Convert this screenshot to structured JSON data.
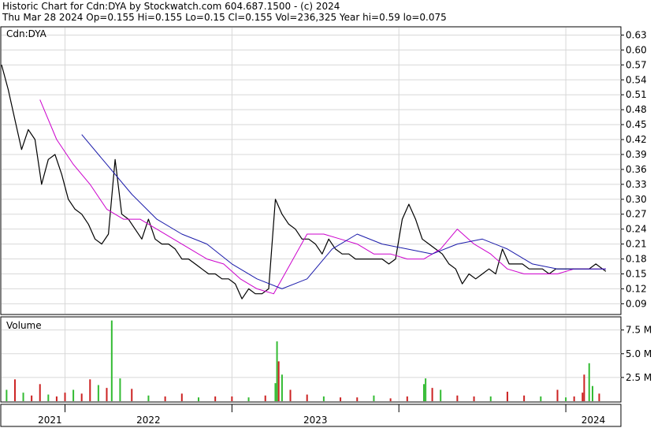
{
  "header": {
    "line1": "Historic Chart for Cdn:DYA by Stockwatch.com 604.687.1500 - (c) 2024",
    "line2": "Thu Mar 28 2024   Op=0.155  Hi=0.155  Lo=0.15  Cl=0.155  Vol=236,325   Year hi=0.59   lo=0.075"
  },
  "chart_data": [
    {
      "type": "line",
      "title": "Cdn:DYA",
      "y_ticks": [
        "0.63",
        "0.60",
        "0.57",
        "0.54",
        "0.51",
        "0.48",
        "0.45",
        "0.42",
        "0.39",
        "0.36",
        "0.33",
        "0.30",
        "0.27",
        "0.24",
        "0.21",
        "0.18",
        "0.15",
        "0.12",
        "0.09"
      ],
      "ylim": [
        0.07,
        0.645
      ],
      "x_labels": [
        "2021",
        "2022",
        "2023",
        "2024"
      ],
      "xlim": [
        2020.62,
        2024.33
      ],
      "grid": true,
      "colors": {
        "price": "#000000",
        "ma_short": "#cc00cc",
        "ma_long": "#1a1aaa"
      },
      "series": [
        {
          "x": [
            2020.62,
            2020.66,
            2020.7,
            2020.74,
            2020.78,
            2020.82,
            2020.86,
            2020.9,
            2020.94,
            2020.98,
            2021.02,
            2021.06,
            2021.1,
            2021.14,
            2021.18,
            2021.22,
            2021.26,
            2021.3,
            2021.34,
            2021.38,
            2021.42,
            2021.46,
            2021.5,
            2021.54,
            2021.58,
            2021.62,
            2021.66,
            2021.7,
            2021.74,
            2021.78,
            2021.82,
            2021.86,
            2021.9,
            2021.94,
            2021.98,
            2022.02,
            2022.06,
            2022.1,
            2022.14,
            2022.18,
            2022.22,
            2022.26,
            2022.3,
            2022.34,
            2022.38,
            2022.42,
            2022.46,
            2022.5,
            2022.54,
            2022.58,
            2022.62,
            2022.66,
            2022.7,
            2022.74,
            2022.78,
            2022.82,
            2022.86,
            2022.9,
            2022.94,
            2022.98,
            2023.02,
            2023.06,
            2023.1,
            2023.14,
            2023.18,
            2023.22,
            2023.26,
            2023.3,
            2023.34,
            2023.38,
            2023.42,
            2023.46,
            2023.5,
            2023.54,
            2023.58,
            2023.62,
            2023.66,
            2023.7,
            2023.74,
            2023.78,
            2023.82,
            2023.86,
            2023.9,
            2023.94,
            2023.98,
            2024.02,
            2024.06,
            2024.1,
            2024.14,
            2024.18,
            2024.22,
            2024.24
          ],
          "values": [
            0.57,
            0.52,
            0.46,
            0.4,
            0.44,
            0.42,
            0.33,
            0.38,
            0.39,
            0.35,
            0.3,
            0.28,
            0.27,
            0.25,
            0.22,
            0.21,
            0.23,
            0.38,
            0.27,
            0.26,
            0.24,
            0.22,
            0.26,
            0.22,
            0.21,
            0.21,
            0.2,
            0.18,
            0.18,
            0.17,
            0.16,
            0.15,
            0.15,
            0.14,
            0.14,
            0.13,
            0.1,
            0.12,
            0.11,
            0.11,
            0.12,
            0.3,
            0.27,
            0.25,
            0.24,
            0.22,
            0.22,
            0.21,
            0.19,
            0.22,
            0.2,
            0.19,
            0.19,
            0.18,
            0.18,
            0.18,
            0.18,
            0.18,
            0.17,
            0.18,
            0.26,
            0.29,
            0.26,
            0.22,
            0.21,
            0.2,
            0.19,
            0.17,
            0.16,
            0.13,
            0.15,
            0.14,
            0.15,
            0.16,
            0.15,
            0.2,
            0.17,
            0.17,
            0.17,
            0.16,
            0.16,
            0.16,
            0.15,
            0.16,
            0.16,
            0.16,
            0.16,
            0.16,
            0.16,
            0.17,
            0.16,
            0.155
          ]
        },
        {
          "x": [
            2020.85,
            2020.95,
            2021.05,
            2021.15,
            2021.25,
            2021.35,
            2021.45,
            2021.55,
            2021.65,
            2021.75,
            2021.85,
            2021.95,
            2022.05,
            2022.15,
            2022.25,
            2022.35,
            2022.45,
            2022.55,
            2022.65,
            2022.75,
            2022.85,
            2022.95,
            2023.05,
            2023.15,
            2023.25,
            2023.35,
            2023.45,
            2023.55,
            2023.65,
            2023.75,
            2023.85,
            2023.95,
            2024.05,
            2024.15,
            2024.24
          ],
          "values": [
            0.5,
            0.42,
            0.37,
            0.33,
            0.28,
            0.26,
            0.26,
            0.24,
            0.22,
            0.2,
            0.18,
            0.17,
            0.14,
            0.12,
            0.11,
            0.17,
            0.23,
            0.23,
            0.22,
            0.21,
            0.19,
            0.19,
            0.18,
            0.18,
            0.2,
            0.24,
            0.21,
            0.19,
            0.16,
            0.15,
            0.15,
            0.15,
            0.16,
            0.16,
            0.16
          ]
        },
        {
          "x": [
            2021.1,
            2021.25,
            2021.4,
            2021.55,
            2021.7,
            2021.85,
            2022.0,
            2022.15,
            2022.3,
            2022.45,
            2022.6,
            2022.75,
            2022.9,
            2023.05,
            2023.2,
            2023.35,
            2023.5,
            2023.65,
            2023.8,
            2023.95,
            2024.1,
            2024.24
          ],
          "values": [
            0.43,
            0.37,
            0.31,
            0.26,
            0.23,
            0.21,
            0.17,
            0.14,
            0.12,
            0.14,
            0.2,
            0.23,
            0.21,
            0.2,
            0.19,
            0.21,
            0.22,
            0.2,
            0.17,
            0.16,
            0.16,
            0.16
          ]
        }
      ]
    },
    {
      "type": "bar",
      "title": "Volume",
      "y_ticks": [
        "7.5 M",
        "5.0 M",
        "2.5 M"
      ],
      "ylim": [
        0,
        8.8
      ],
      "colors": {
        "up": "#33bb33",
        "down": "#cc2222"
      },
      "series": [
        {
          "x": [
            2020.65,
            2020.7,
            2020.75,
            2020.8,
            2020.85,
            2020.9,
            2020.95,
            2021.0,
            2021.05,
            2021.1,
            2021.15,
            2021.2,
            2021.25,
            2021.28,
            2021.33,
            2021.4,
            2021.5,
            2021.6,
            2021.7,
            2021.8,
            2021.9,
            2022.0,
            2022.1,
            2022.2,
            2022.26,
            2022.27,
            2022.28,
            2022.3,
            2022.35,
            2022.45,
            2022.55,
            2022.65,
            2022.75,
            2022.85,
            2022.95,
            2023.05,
            2023.15,
            2023.16,
            2023.2,
            2023.25,
            2023.35,
            2023.45,
            2023.55,
            2023.65,
            2023.75,
            2023.85,
            2023.95,
            2024.0,
            2024.05,
            2024.1,
            2024.11,
            2024.14,
            2024.16,
            2024.2
          ],
          "values": [
            1.2,
            2.3,
            0.9,
            0.6,
            1.8,
            0.7,
            0.5,
            0.9,
            1.2,
            0.8,
            2.3,
            1.7,
            1.4,
            8.5,
            2.4,
            1.3,
            0.6,
            0.5,
            0.8,
            0.4,
            0.5,
            0.5,
            0.4,
            0.6,
            1.9,
            6.3,
            4.2,
            2.8,
            1.2,
            0.7,
            0.5,
            0.4,
            0.4,
            0.6,
            0.3,
            0.5,
            1.8,
            2.4,
            1.4,
            1.2,
            0.6,
            0.5,
            0.5,
            1.0,
            0.6,
            0.5,
            1.2,
            0.4,
            0.5,
            0.9,
            2.8,
            4.0,
            1.6,
            0.8
          ],
          "up": [
            true,
            false,
            true,
            false,
            false,
            true,
            false,
            false,
            true,
            false,
            false,
            true,
            false,
            true,
            true,
            false,
            true,
            false,
            false,
            true,
            false,
            false,
            true,
            false,
            true,
            true,
            false,
            true,
            false,
            false,
            true,
            false,
            false,
            true,
            false,
            false,
            true,
            true,
            false,
            true,
            false,
            false,
            true,
            false,
            false,
            true,
            false,
            true,
            false,
            false,
            false,
            true,
            true,
            false
          ]
        }
      ]
    }
  ]
}
